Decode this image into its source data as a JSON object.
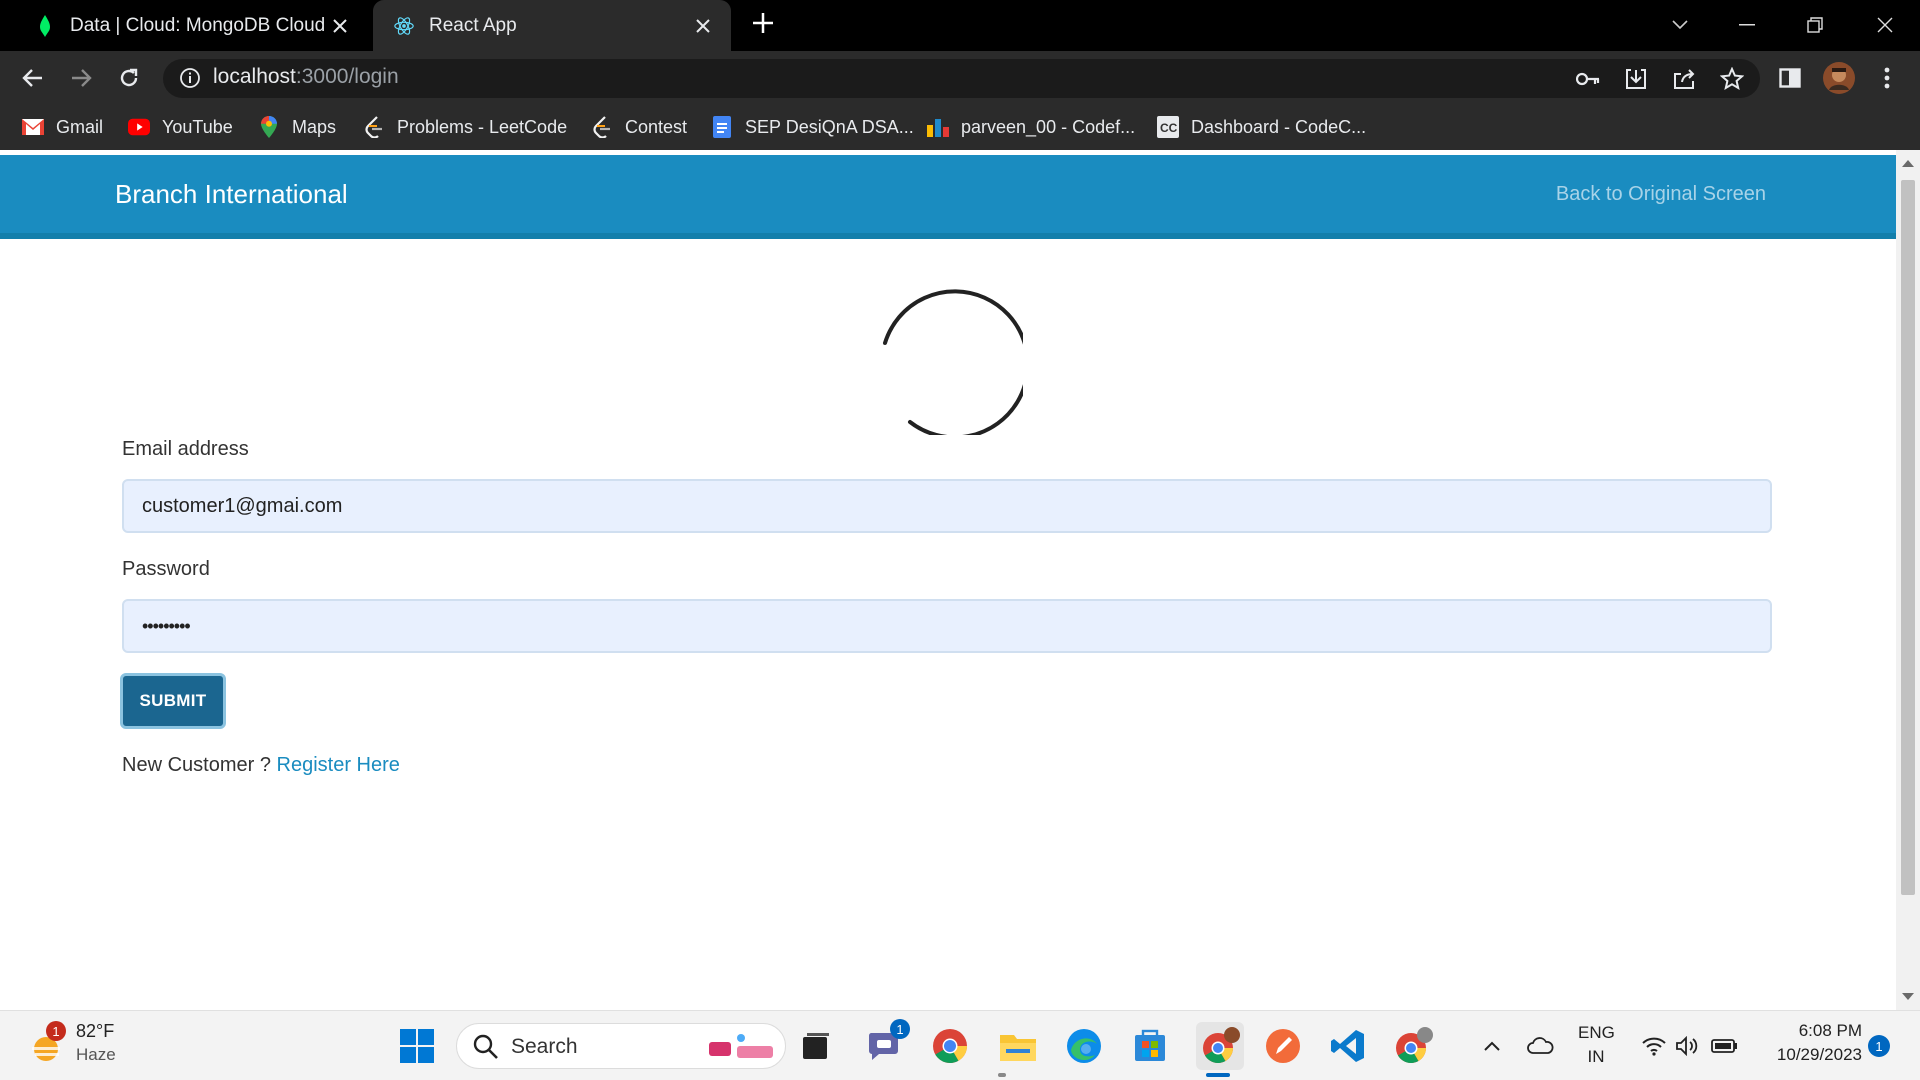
{
  "browser": {
    "tabs": [
      {
        "title": "Data | Cloud: MongoDB Cloud",
        "active": false,
        "icon": "mongodb-leaf-icon"
      },
      {
        "title": "React App",
        "active": true,
        "icon": "react-icon"
      }
    ],
    "url_host": "localhost",
    "url_path": ":3000/login",
    "bookmarks": [
      {
        "label": "Gmail",
        "icon": "gmail-icon"
      },
      {
        "label": "YouTube",
        "icon": "youtube-icon"
      },
      {
        "label": "Maps",
        "icon": "maps-icon"
      },
      {
        "label": "Problems - LeetCode",
        "icon": "leetcode-icon"
      },
      {
        "label": "Contest",
        "icon": "leetcode-icon"
      },
      {
        "label": "SEP DesiQnA DSA...",
        "icon": "docs-icon"
      },
      {
        "label": "parveen_00 - Codef...",
        "icon": "codeforces-icon"
      },
      {
        "label": "Dashboard - CodeC...",
        "icon": "codechef-icon"
      }
    ]
  },
  "app": {
    "brand": "Branch International",
    "back_link": "Back to Original Screen",
    "email_label": "Email address",
    "email_value": "customer1@gmai.com",
    "password_label": "Password",
    "password_value": "•••••••••",
    "submit_label": "SUBMIT",
    "new_customer_text": "New Customer ? ",
    "register_link": "Register Here",
    "colors": {
      "navbar": "#1a8cc0",
      "submit": "#1b6690",
      "link": "#1a8cc0",
      "input_bg": "#e8f0fe"
    }
  },
  "taskbar": {
    "weather_temp": "82°F",
    "weather_desc": "Haze",
    "weather_badge": "1",
    "search_label": "Search",
    "chat_badge": "1",
    "lang_top": "ENG",
    "lang_bottom": "IN",
    "time": "6:08 PM",
    "date": "10/29/2023",
    "notification_count": "1"
  }
}
